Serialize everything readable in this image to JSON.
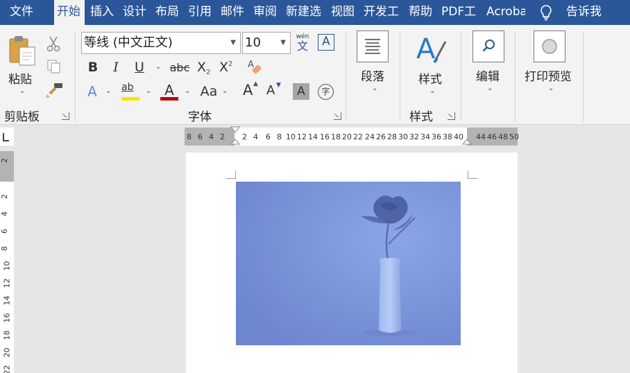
{
  "tabs": [
    {
      "label": "文件",
      "active": false
    },
    {
      "label": "开始",
      "active": true
    },
    {
      "label": "插入",
      "active": false
    },
    {
      "label": "设计",
      "active": false
    },
    {
      "label": "布局",
      "active": false
    },
    {
      "label": "引用",
      "active": false
    },
    {
      "label": "邮件",
      "active": false
    },
    {
      "label": "审阅",
      "active": false
    },
    {
      "label": "新建选",
      "active": false
    },
    {
      "label": "视图",
      "active": false
    },
    {
      "label": "开发工",
      "active": false
    },
    {
      "label": "帮助",
      "active": false
    },
    {
      "label": "PDF工",
      "active": false
    },
    {
      "label": "Acroba",
      "active": false
    }
  ],
  "tell_me": "告诉我",
  "clipboard": {
    "paste_label": "粘贴",
    "group_label": "剪贴板"
  },
  "font": {
    "name": "等线 (中文正文)",
    "size": "10",
    "group_label": "字体",
    "phonetic_top": "wén",
    "phonetic_bottom": "文",
    "border_char": "A",
    "bold": "B",
    "italic": "I",
    "underline": "U",
    "strike": "abc",
    "sub_base": "X",
    "sub_mark": "2",
    "sup_base": "X",
    "sup_mark": "2",
    "effects": "A",
    "highlight": "ab",
    "font_color": "A",
    "change_case": "Aa",
    "grow": "A",
    "shrink": "A",
    "shading": "A",
    "enclose": "字"
  },
  "paragraph": {
    "label": "段落"
  },
  "styles": {
    "label": "样式",
    "group_label": "样式"
  },
  "editing": {
    "label": "编辑"
  },
  "print_preview": {
    "label": "打印预览"
  },
  "hruler": {
    "ticks": [
      "8",
      "6",
      "4",
      "2",
      "2",
      "4",
      "6",
      "8",
      "10",
      "12",
      "14",
      "16",
      "18",
      "20",
      "22",
      "24",
      "26",
      "28",
      "30",
      "32",
      "34",
      "36",
      "38",
      "40",
      "44",
      "46",
      "48",
      "50"
    ]
  },
  "vruler": {
    "ticks": [
      "2",
      "2",
      "4",
      "6",
      "8",
      "10",
      "12",
      "14",
      "16",
      "18",
      "20",
      "22"
    ]
  },
  "colors": {
    "accent": "#2b579a",
    "ribbon": "#f3f3f3",
    "photo_tint": "#7b95d8"
  }
}
